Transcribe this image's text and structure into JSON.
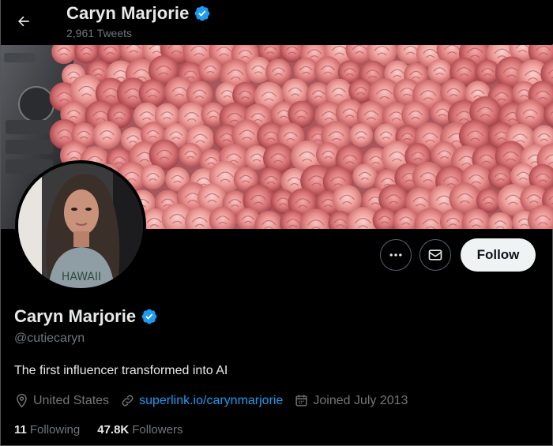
{
  "header": {
    "name": "Caryn Marjorie",
    "tweet_count": "2,961 Tweets"
  },
  "profile": {
    "name": "Caryn Marjorie",
    "handle": "@cutiecaryn",
    "bio": "The first influencer transformed into AI",
    "location": "United States",
    "website": "superlink.io/carynmarjorie",
    "joined": "Joined July 2013",
    "following_count": "11",
    "following_label": "Following",
    "followers_count": "47.8K",
    "followers_label": "Followers",
    "avatar_shirt_text": "HAWAII"
  },
  "actions": {
    "follow_label": "Follow"
  },
  "icons": {
    "back": "arrow-left-icon",
    "verified": "verified-badge-icon",
    "more": "more-horizontal-icon",
    "message": "envelope-icon",
    "location": "map-pin-icon",
    "link": "link-icon",
    "calendar": "calendar-icon"
  },
  "colors": {
    "background": "#000000",
    "text_primary": "#e7e9ea",
    "text_secondary": "#71767b",
    "link": "#1d9bf0",
    "verified": "#1d9bf0",
    "follow_button_bg": "#eff3f4"
  }
}
